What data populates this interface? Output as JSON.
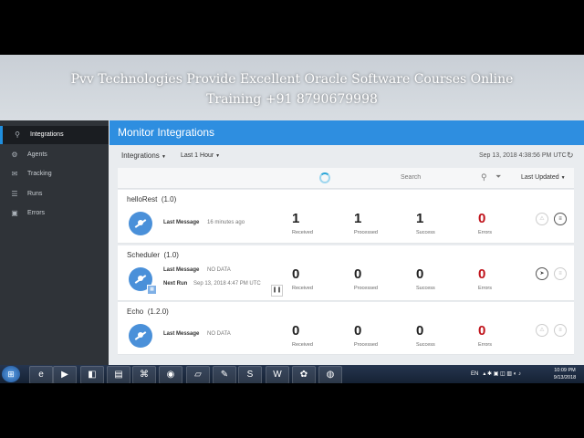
{
  "banner": {
    "line1": "Pvv Technologies Provide  Excellent Oracle Software Courses Online",
    "line2": "Training +91 8790679998"
  },
  "sidebar": {
    "items": [
      {
        "label": "Integrations",
        "icon": "integrations-icon",
        "active": true
      },
      {
        "label": "Agents",
        "icon": "gear-icon",
        "active": false
      },
      {
        "label": "Tracking",
        "icon": "envelope-icon",
        "active": false
      },
      {
        "label": "Runs",
        "icon": "list-icon",
        "active": false
      },
      {
        "label": "Errors",
        "icon": "briefcase-icon",
        "active": false
      }
    ]
  },
  "header": {
    "title": "Monitor Integrations"
  },
  "filters": {
    "scope": "Integrations",
    "range": "Last 1 Hour",
    "timestamp": "Sep 13, 2018 4:38:56 PM UTC"
  },
  "search": {
    "placeholder": "Search",
    "sort": "Last Updated"
  },
  "labels": {
    "received": "Received",
    "processed": "Processed",
    "success": "Success",
    "errors": "Errors",
    "last_message": "Last Message",
    "next_run": "Next Run"
  },
  "integrations": [
    {
      "name": "helloRest",
      "version": "(1.0)",
      "last_message": "16 minutes ago",
      "received": "1",
      "processed": "1",
      "success": "1",
      "errors": "0"
    },
    {
      "name": "Scheduler",
      "version": "(1.0)",
      "last_message": "NO DATA",
      "next_run": "Sep 13, 2018 4:47 PM UTC",
      "received": "0",
      "processed": "0",
      "success": "0",
      "errors": "0"
    },
    {
      "name": "Echo",
      "version": "(1.2.0)",
      "last_message": "NO DATA",
      "received": "0",
      "processed": "0",
      "success": "0",
      "errors": "0"
    }
  ],
  "taskbar": {
    "apps": [
      "internet-explorer-icon",
      "media-player-icon",
      "folder-icon",
      "explorer-icon",
      "network-icon",
      "chrome-icon",
      "notes-icon",
      "paint-icon",
      "skype-icon",
      "word-icon",
      "app-icon",
      "firefox-icon"
    ],
    "tray_lang": "EN",
    "clock_time": "10:09 PM",
    "clock_date": "9/13/2018"
  },
  "colors": {
    "accent": "#2e8ee0",
    "error": "#c0121a",
    "sidebar": "#2f3338"
  }
}
